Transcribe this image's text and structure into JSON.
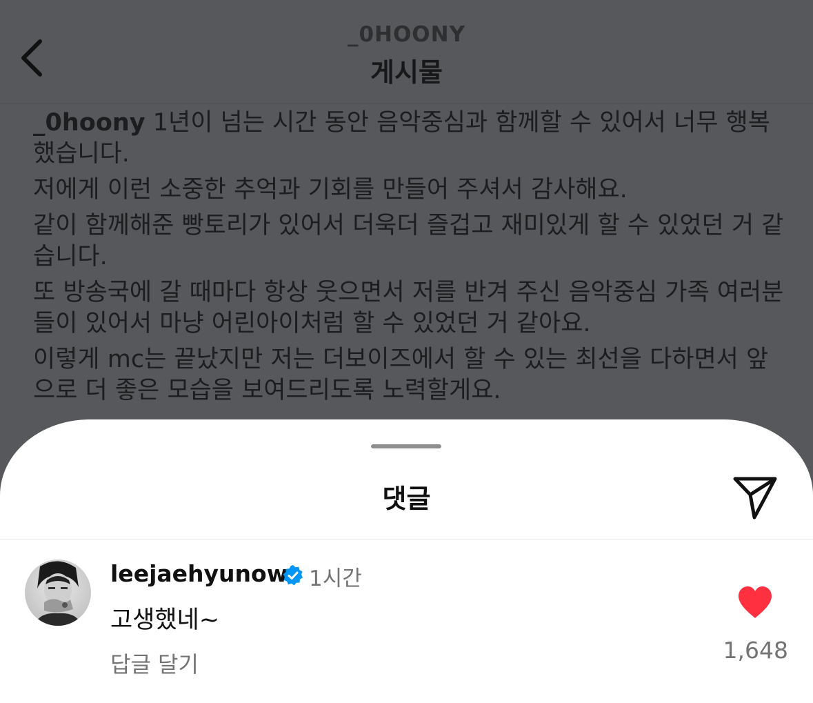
{
  "header": {
    "username": "_0HOONY",
    "title": "게시물"
  },
  "caption": {
    "author": "_0hoony",
    "paragraphs": [
      "1년이 넘는 시간 동안 음악중심과 함께할 수 있어서 너무 행복했습니다.",
      "저에게 이런 소중한 추억과 기회를 만들어 주셔서 감사해요.",
      "같이 함께해준 빵토리가 있어서 더욱더 즐겁고 재미있게 할 수 있었던 거 같습니다.",
      "또 방송국에 갈 때마다 항상 웃으면서 저를 반겨 주신 음악중심 가족 여러분들이 있어서 마냥 어린아이처럼 할 수 있었던 거 같아요.",
      "이렇게 mc는 끝났지만 저는 더보이즈에서 할 수 있는 최선을 다하면서 앞으로 더 좋은 모습을 보여드리도록 노력할게요."
    ]
  },
  "comments_sheet": {
    "title": "댓글"
  },
  "comment": {
    "username": "leejaehyunow",
    "time": "1시간",
    "text": "고생했네~",
    "reply_label": "답글 달기",
    "like_count": "1,648"
  },
  "icons": {
    "back": "chevron-left-icon",
    "share": "paper-plane-icon",
    "verified": "verified-badge-icon",
    "like": "heart-filled-icon"
  },
  "colors": {
    "verified": "#0095f6",
    "like": "#ff3040",
    "dim_overlay": "#56585b"
  }
}
